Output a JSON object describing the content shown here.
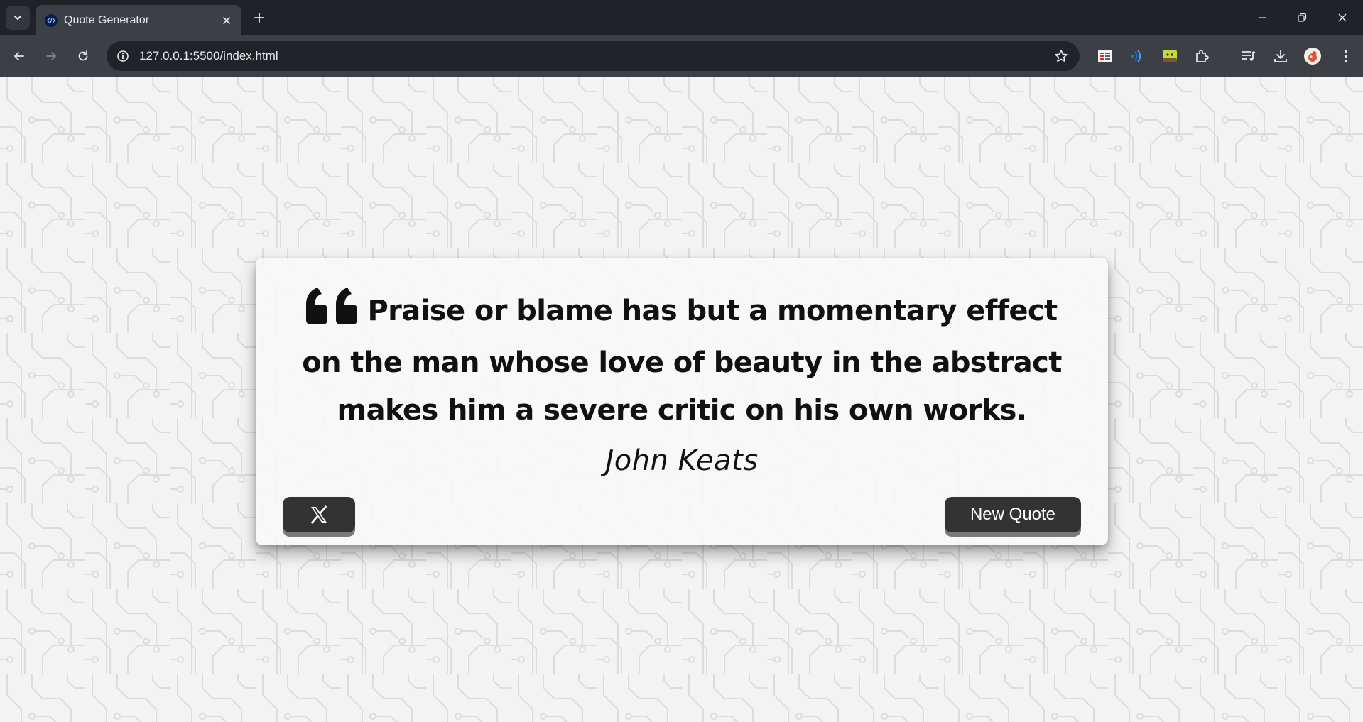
{
  "browser": {
    "tab_title": "Quote Generator",
    "url": "127.0.0.1:5500/index.html",
    "icons": {
      "tab_search": "chevron-down-icon",
      "favicon": "code-icon",
      "tab_close": "close-icon",
      "new_tab": "plus-icon",
      "minimize": "minimize-icon",
      "restore": "restore-icon",
      "close_window": "close-icon",
      "back": "back-arrow-icon",
      "forward": "forward-arrow-icon",
      "reload": "reload-icon",
      "site_info": "info-icon",
      "bookmark": "star-icon",
      "extensions": [
        "list-extension-icon",
        "audio-extension-icon",
        "green-extension-icon",
        "puzzle-icon"
      ],
      "media": "playlist-icon",
      "downloads": "download-icon",
      "profile": "avatar-icon",
      "menu": "kebab-menu-icon"
    }
  },
  "quote": {
    "text": "Praise or blame has but a momentary effect on the man whose love of beauty in the abstract makes him a severe critic on his own works.",
    "author": "John Keats"
  },
  "buttons": {
    "tweet_icon": "x-logo-icon",
    "new_quote_label": "New Quote"
  },
  "colors": {
    "chrome_dark": "#1f2327",
    "chrome_toolbar": "#3c4046",
    "button_bg": "#333333",
    "button_shadow": "#7a7a7a",
    "page_bg": "#f3f3f3"
  }
}
